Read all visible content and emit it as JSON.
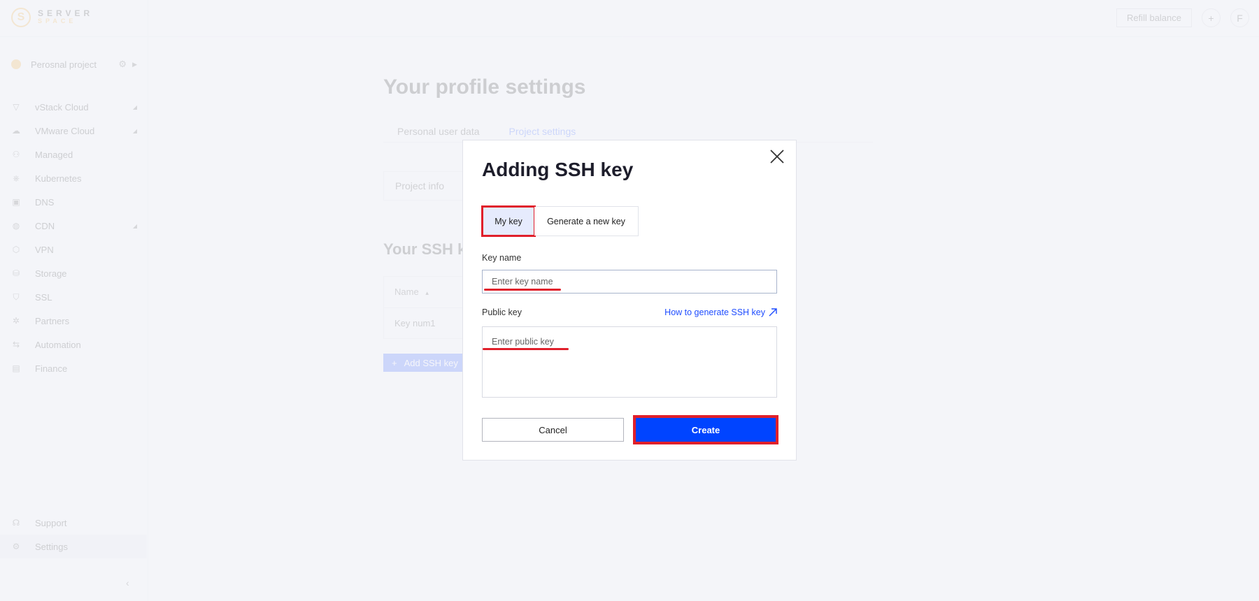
{
  "brand": {
    "name_line1": "SERVER",
    "name_line2": "SPACE",
    "logo_glyph": "S",
    "accent_color": "#f2a72a"
  },
  "topbar": {
    "refill_label": "Refill balance",
    "add_icon": "+",
    "avatar_initial": "F"
  },
  "sidebar": {
    "project_name": "Perosnal project",
    "items": [
      {
        "label": "vStack Cloud",
        "icon": "vstack-icon",
        "glyph": "▽",
        "expandable": true
      },
      {
        "label": "VMware Cloud",
        "icon": "cloud-icon",
        "glyph": "☁",
        "expandable": true
      },
      {
        "label": "Managed",
        "icon": "user-icon",
        "glyph": "⚇",
        "expandable": false
      },
      {
        "label": "Kubernetes",
        "icon": "kubernetes-icon",
        "glyph": "⎈",
        "expandable": false
      },
      {
        "label": "DNS",
        "icon": "dns-icon",
        "glyph": "▣",
        "expandable": false
      },
      {
        "label": "CDN",
        "icon": "globe-icon",
        "glyph": "◍",
        "expandable": true
      },
      {
        "label": "VPN",
        "icon": "vpn-icon",
        "glyph": "⬡",
        "expandable": false
      },
      {
        "label": "Storage",
        "icon": "database-icon",
        "glyph": "⛁",
        "expandable": false
      },
      {
        "label": "SSL",
        "icon": "shield-icon",
        "glyph": "⛉",
        "expandable": false
      },
      {
        "label": "Partners",
        "icon": "partners-icon",
        "glyph": "✲",
        "expandable": false
      },
      {
        "label": "Automation",
        "icon": "automation-icon",
        "glyph": "⇆",
        "expandable": false
      },
      {
        "label": "Finance",
        "icon": "document-icon",
        "glyph": "▤",
        "expandable": false
      }
    ],
    "bottom_items": [
      {
        "label": "Support",
        "icon": "headset-icon",
        "glyph": "☊"
      },
      {
        "label": "Settings",
        "icon": "gear-icon",
        "glyph": "⚙"
      }
    ],
    "collapse_glyph": "‹"
  },
  "page": {
    "title": "Your profile settings",
    "tabs": [
      "Personal user data",
      "Project settings"
    ],
    "project_info_label": "Project info",
    "ssh_section_title": "Your SSH keys",
    "table_header": "Name",
    "table_sort_glyph": "▴",
    "table_rows": [
      "Key num1"
    ],
    "add_ssh_label": "Add SSH key"
  },
  "modal": {
    "title": "Adding SSH key",
    "tabs": [
      "My key",
      "Generate a new key"
    ],
    "key_name_label": "Key name",
    "key_name_placeholder": "Enter key name",
    "key_name_value": "",
    "public_key_label": "Public key",
    "public_key_placeholder": "Enter public key",
    "public_key_value": "",
    "help_link": "How to generate SSH key",
    "cancel_label": "Cancel",
    "create_label": "Create",
    "primary_color": "#0044ff",
    "highlight_color": "#e0202b"
  }
}
